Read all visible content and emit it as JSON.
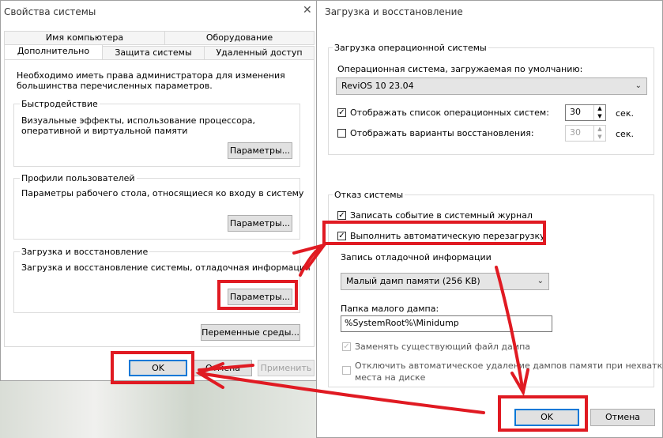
{
  "left_dialog": {
    "title": "Свойства системы",
    "tabs_row1": [
      "Имя компьютера",
      "Оборудование"
    ],
    "tabs_row2": [
      "Дополнительно",
      "Защита системы",
      "Удаленный доступ"
    ],
    "admin_note": "Необходимо иметь права администратора для изменения большинства перечисленных параметров.",
    "performance": {
      "title": "Быстродействие",
      "desc": "Визуальные эффекты, использование процессора, оперативной и виртуальной памяти",
      "button": "Параметры..."
    },
    "profiles": {
      "title": "Профили пользователей",
      "desc": "Параметры рабочего стола, относящиеся ко входу в систему",
      "button": "Параметры..."
    },
    "startup": {
      "title": "Загрузка и восстановление",
      "desc": "Загрузка и восстановление системы, отладочная информация",
      "button": "Параметры..."
    },
    "env_button": "Переменные среды...",
    "ok": "OK",
    "cancel": "Отмена",
    "apply": "Применить"
  },
  "right_dialog": {
    "title": "Загрузка и восстановление",
    "boot_group": {
      "title": "Загрузка операционной системы",
      "default_os_label": "Операционная система, загружаемая по умолчанию:",
      "default_os_value": "ReviOS 10 23.04",
      "show_os_list_label": "Отображать список операционных систем:",
      "show_os_list_checked": true,
      "show_os_list_value": "30",
      "show_recovery_label": "Отображать варианты восстановления:",
      "show_recovery_checked": false,
      "show_recovery_value": "30",
      "sec": "сек."
    },
    "failure_group": {
      "title": "Отказ системы",
      "write_event_label": "Записать событие в системный журнал",
      "write_event_checked": true,
      "auto_restart_label": "Выполнить автоматическую перезагрузку",
      "auto_restart_checked": true,
      "debug_info_label": "Запись отладочной информации",
      "dump_type": "Малый дамп памяти (256 KB)",
      "dump_folder_label": "Папка малого дампа:",
      "dump_folder_value": "%SystemRoot%\\Minidump",
      "overwrite_label": "Заменять существующий файл дампа",
      "overwrite_checked": true,
      "disable_auto_delete_label_1": "Отключить автоматическое удаление дампов памяти при нехватке",
      "disable_auto_delete_label_2": "места на диске",
      "disable_auto_delete_checked": false
    },
    "ok": "OK",
    "cancel": "Отмена"
  },
  "annotation_color": "#e01a22"
}
